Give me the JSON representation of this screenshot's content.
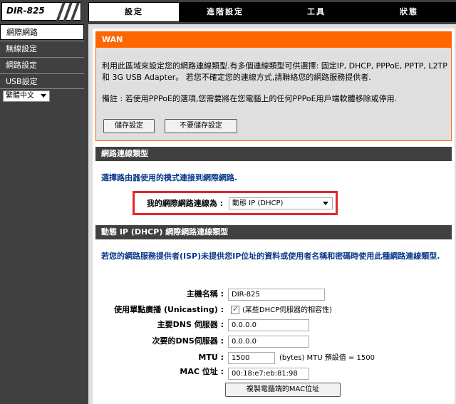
{
  "header": {
    "logo": "DIR-825",
    "tabs": [
      {
        "label": "設定",
        "active": true
      },
      {
        "label": "進階設定",
        "active": false
      },
      {
        "label": "工具",
        "active": false
      },
      {
        "label": "狀態",
        "active": false
      }
    ]
  },
  "sidebar": {
    "items": [
      {
        "label": "網際網路",
        "active": true
      },
      {
        "label": "無線設定",
        "active": false
      },
      {
        "label": "網路設定",
        "active": false
      },
      {
        "label": "USB設定",
        "active": false
      }
    ],
    "language": "繁體中文"
  },
  "wan": {
    "title": "WAN",
    "description": "利用此區域來設定您的網路連線類型.有多個連線類型可供選擇: 固定IP, DHCP, PPPoE, PPTP, L2TP 和 3G USB Adapter。 若您不確定您的連線方式,請聯絡您的網路服務提供者.",
    "note": "備註 : 若使用PPPoE的選項,您需要將在您電腦上的任何PPPoE用戶端軟體移除或停用.",
    "save_label": "儲存設定",
    "dont_save_label": "不要儲存設定"
  },
  "connection_type": {
    "header": "網路連線類型",
    "instruction": "選擇路由器使用的模式連接到網際網路.",
    "label": "我的網際網路連線為 :",
    "selected": "動態 IP (DHCP)"
  },
  "dhcp": {
    "header": "動態 IP (DHCP) 網際網路連線類型",
    "instruction": "若您的網路服務提供者(ISP)未提供您IP位址的資料或使用者名稱和密碼時使用此種網路連線類型.",
    "host_name_label": "主機名稱 :",
    "host_name": "DIR-825",
    "unicast_label": "使用單點廣播 (Unicasting) :",
    "unicast_checked": true,
    "unicast_note": "(某些DHCP伺服器的相容性)",
    "dns1_label": "主要DNS 伺服器 :",
    "dns1": "0.0.0.0",
    "dns2_label": "次要的DNS伺服器 :",
    "dns2": "0.0.0.0",
    "mtu_label": "MTU :",
    "mtu": "1500",
    "mtu_note": "(bytes) MTU 預設值 = 1500",
    "mac_label": "MAC 位址 :",
    "mac": "00:18:e7:eb:81:98",
    "clone_mac_label": "複製電腦端的MAC位址"
  }
}
